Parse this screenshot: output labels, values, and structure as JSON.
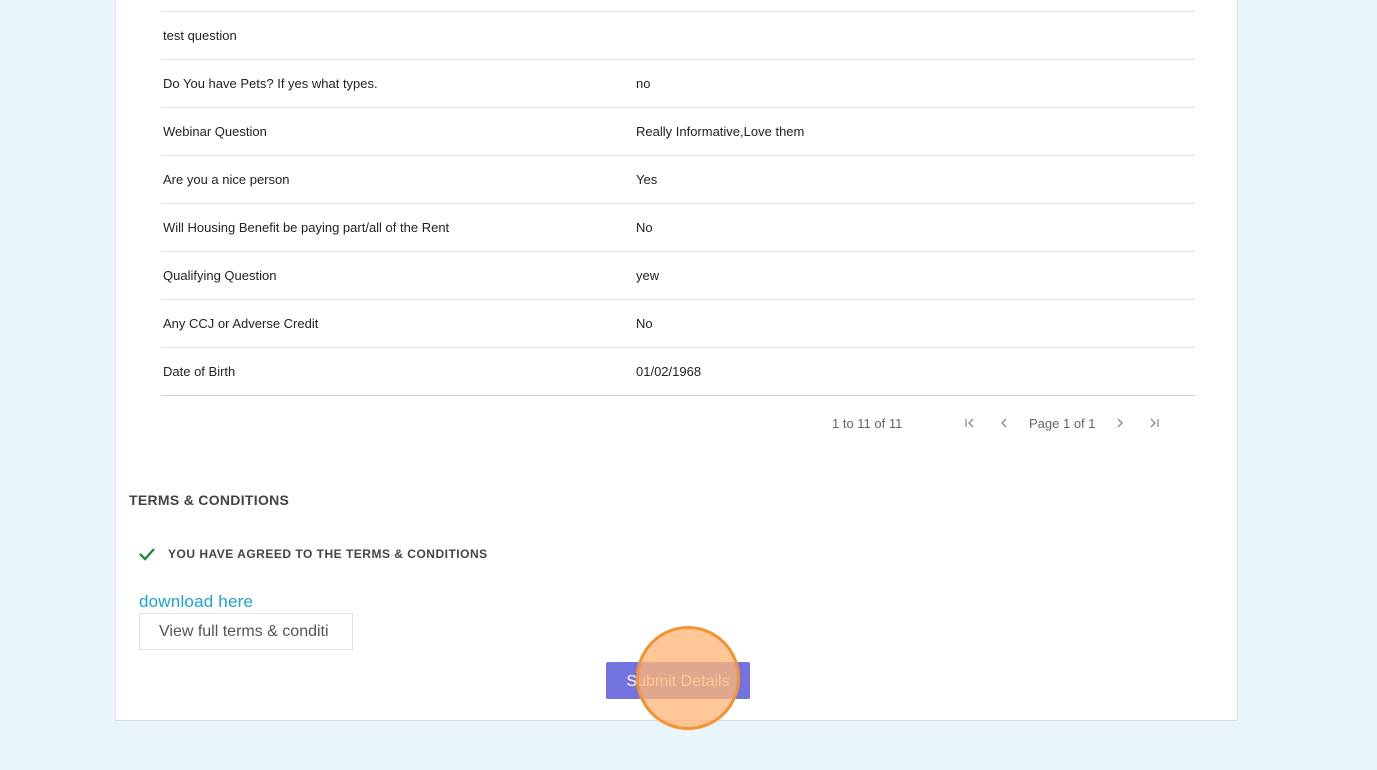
{
  "questions": [
    {
      "question": "test question",
      "answer": ""
    },
    {
      "question": "Do You have Pets? If yes what types.",
      "answer": "no"
    },
    {
      "question": "Webinar Question",
      "answer": "Really Informative,Love them"
    },
    {
      "question": "Are you a nice person",
      "answer": "Yes"
    },
    {
      "question": "Will Housing Benefit be paying part/all of the Rent",
      "answer": "No"
    },
    {
      "question": "Qualifying Question",
      "answer": "yew"
    },
    {
      "question": "Any CCJ or Adverse Credit",
      "answer": "No"
    },
    {
      "question": "Date of Birth",
      "answer": "01/02/1968"
    }
  ],
  "pagination": {
    "range": "1 to 11 of 11",
    "page_info": "Page 1 of 1",
    "icons": [
      "first-page-icon",
      "prev-page-icon",
      "next-page-icon",
      "last-page-icon"
    ]
  },
  "terms": {
    "title": "TERMS & CONDITIONS",
    "agreed_text": "YOU HAVE AGREED TO THE TERMS & CONDITIONS",
    "download_link": "download here",
    "view_button": "View full terms & conditi",
    "check_icon": "checkmark-icon"
  },
  "submit_label": "Submit Details",
  "colors": {
    "background": "#e8f6fb",
    "submit": "#7373df",
    "link": "#1aa3d6",
    "check": "#1e8a3a",
    "click_indicator": "#f39434"
  }
}
